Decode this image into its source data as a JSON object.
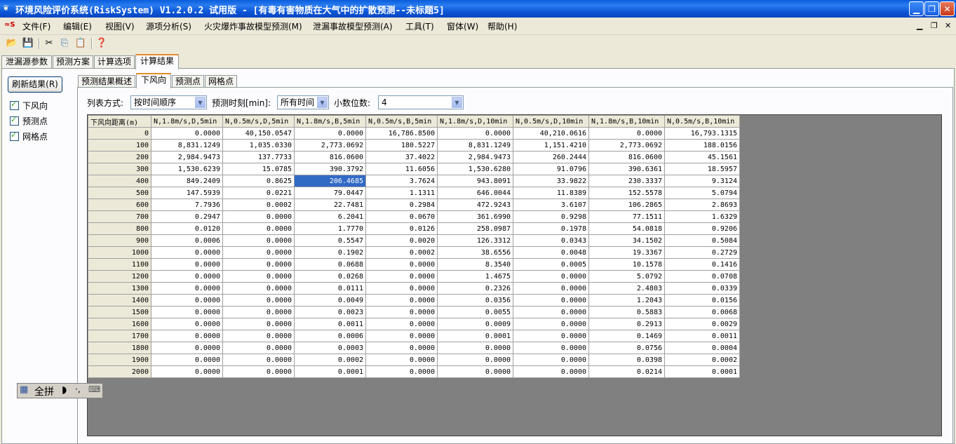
{
  "window": {
    "title": "环境风险评价系统(RiskSystem) V1.2.0.2 试用版 - [有毒有害物质在大气中的扩散预测--未标题5]"
  },
  "menu": {
    "items": [
      "文件(F)",
      "编辑(E)",
      "视图(V)",
      "源项分析(S)",
      "火灾爆炸事故模型预测(M)",
      "泄漏事故模型预测(A)",
      "工具(T)",
      "窗体(W)",
      "帮助(H)"
    ]
  },
  "outer_tabs": [
    "泄漏源参数",
    "预测方案",
    "计算选项",
    "计算结果"
  ],
  "sidebar": {
    "refresh_label": "刷新结果(R)",
    "checkboxes": [
      "下风向",
      "预测点",
      "网格点"
    ]
  },
  "inner_tabs": [
    "预测结果概述",
    "下风向",
    "预测点",
    "网格点"
  ],
  "options": {
    "list_mode_label": "列表方式:",
    "list_mode_value": "按时间顺序",
    "time_label": "预测时刻[min]:",
    "time_value": "所有时间",
    "decimals_label": "小数位数:",
    "decimals_value": "4"
  },
  "ime": {
    "mode": "全拼",
    "punct": "·,"
  },
  "table": {
    "headers": [
      "下风向距离(m)",
      "N,1.8m/s,D,5min",
      "N,0.5m/s,D,5min",
      "N,1.8m/s,B,5min",
      "N,0.5m/s,B,5min",
      "N,1.8m/s,D,10min",
      "N,0.5m/s,D,10min",
      "N,1.8m/s,B,10min",
      "N,0.5m/s,B,10min"
    ],
    "rows": [
      [
        "0",
        "0.0000",
        "40,150.0547",
        "0.0000",
        "16,786.8500",
        "0.0000",
        "40,210.0616",
        "0.0000",
        "16,793.1315"
      ],
      [
        "100",
        "8,831.1249",
        "1,035.0330",
        "2,773.0692",
        "180.5227",
        "8,831.1249",
        "1,151.4210",
        "2,773.0692",
        "188.0156"
      ],
      [
        "200",
        "2,984.9473",
        "137.7733",
        "816.0600",
        "37.4022",
        "2,984.9473",
        "260.2444",
        "816.0600",
        "45.1561"
      ],
      [
        "300",
        "1,530.6239",
        "15.0785",
        "390.3792",
        "11.6056",
        "1,530.6280",
        "91.0796",
        "390.6361",
        "18.5957"
      ],
      [
        "400",
        "849.2409",
        "0.8625",
        "206.4685",
        "3.7624",
        "943.8091",
        "33.9822",
        "230.3337",
        "9.3124"
      ],
      [
        "500",
        "147.5939",
        "0.0221",
        "79.0447",
        "1.1311",
        "646.0044",
        "11.8389",
        "152.5578",
        "5.0794"
      ],
      [
        "600",
        "7.7936",
        "0.0002",
        "22.7481",
        "0.2984",
        "472.9243",
        "3.6107",
        "106.2865",
        "2.8693"
      ],
      [
        "700",
        "0.2947",
        "0.0000",
        "6.2041",
        "0.0670",
        "361.6990",
        "0.9298",
        "77.1511",
        "1.6329"
      ],
      [
        "800",
        "0.0120",
        "0.0000",
        "1.7770",
        "0.0126",
        "258.0987",
        "0.1978",
        "54.0818",
        "0.9206"
      ],
      [
        "900",
        "0.0006",
        "0.0000",
        "0.5547",
        "0.0020",
        "126.3312",
        "0.0343",
        "34.1502",
        "0.5084"
      ],
      [
        "1000",
        "0.0000",
        "0.0000",
        "0.1902",
        "0.0002",
        "38.6556",
        "0.0048",
        "19.3367",
        "0.2729"
      ],
      [
        "1100",
        "0.0000",
        "0.0000",
        "0.0688",
        "0.0000",
        "8.3540",
        "0.0005",
        "10.1578",
        "0.1416"
      ],
      [
        "1200",
        "0.0000",
        "0.0000",
        "0.0268",
        "0.0000",
        "1.4675",
        "0.0000",
        "5.0792",
        "0.0708"
      ],
      [
        "1300",
        "0.0000",
        "0.0000",
        "0.0111",
        "0.0000",
        "0.2326",
        "0.0000",
        "2.4803",
        "0.0339"
      ],
      [
        "1400",
        "0.0000",
        "0.0000",
        "0.0049",
        "0.0000",
        "0.0356",
        "0.0000",
        "1.2043",
        "0.0156"
      ],
      [
        "1500",
        "0.0000",
        "0.0000",
        "0.0023",
        "0.0000",
        "0.0055",
        "0.0000",
        "0.5883",
        "0.0068"
      ],
      [
        "1600",
        "0.0000",
        "0.0000",
        "0.0011",
        "0.0000",
        "0.0009",
        "0.0000",
        "0.2913",
        "0.0029"
      ],
      [
        "1700",
        "0.0000",
        "0.0000",
        "0.0006",
        "0.0000",
        "0.0001",
        "0.0000",
        "0.1469",
        "0.0011"
      ],
      [
        "1800",
        "0.0000",
        "0.0000",
        "0.0003",
        "0.0000",
        "0.0000",
        "0.0000",
        "0.0756",
        "0.0004"
      ],
      [
        "1900",
        "0.0000",
        "0.0000",
        "0.0002",
        "0.0000",
        "0.0000",
        "0.0000",
        "0.0398",
        "0.0002"
      ],
      [
        "2000",
        "0.0000",
        "0.0000",
        "0.0001",
        "0.0000",
        "0.0000",
        "0.0000",
        "0.0214",
        "0.0001"
      ]
    ],
    "selected_cell": {
      "row": 4,
      "col": 3
    }
  }
}
